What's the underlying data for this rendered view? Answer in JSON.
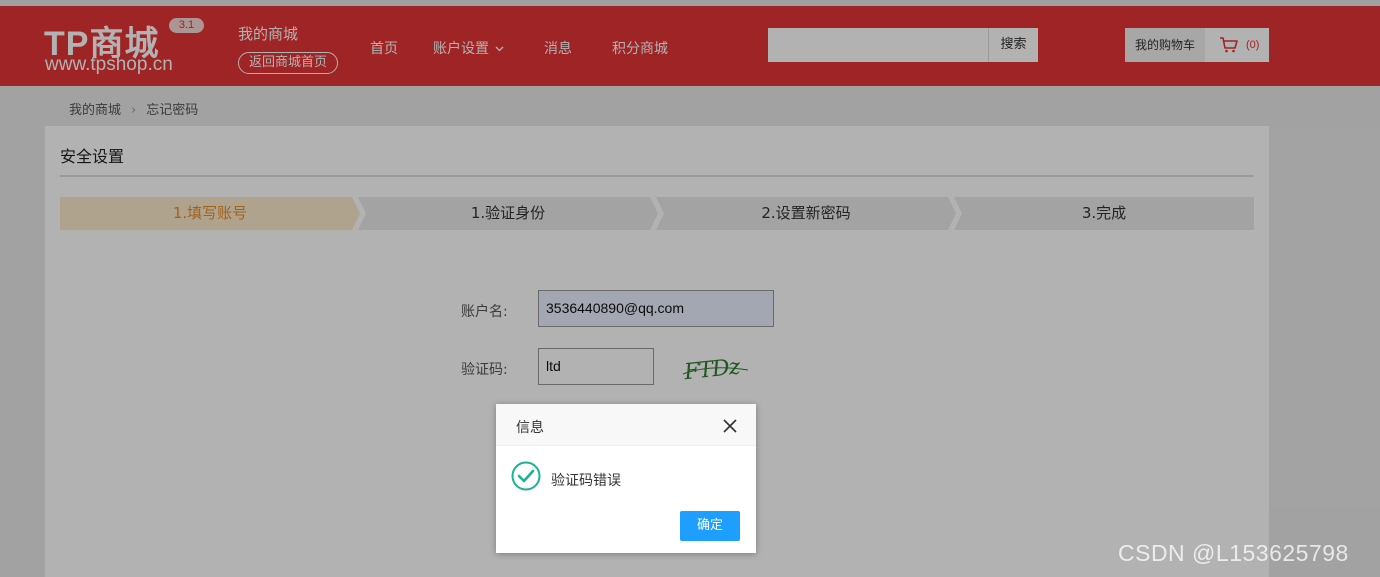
{
  "header": {
    "logo_main": "TP商城",
    "logo_version": "3.1",
    "logo_domain": "www.tpshop.cn",
    "my_mall": "我的商城",
    "back_home": "返回商城首页",
    "nav": [
      {
        "label": "首页"
      },
      {
        "label": "账户设置"
      },
      {
        "label": "消息"
      },
      {
        "label": "积分商城"
      }
    ],
    "search_placeholder": "",
    "search_button": "搜索",
    "cart_label": "我的购物车",
    "cart_count": "(0)",
    "cart_icon": "cart-icon"
  },
  "breadcrumb": {
    "items": [
      "我的商城",
      "忘记密码"
    ],
    "separator": "›"
  },
  "panel": {
    "title": "安全设置",
    "steps": [
      "1.填写账号",
      "1.验证身份",
      "2.设置新密码",
      "3.完成"
    ],
    "form": {
      "account_label": "账户名:",
      "account_value": "3536440890@qq.com",
      "captcha_label": "验证码:",
      "captcha_value": "ltd",
      "captcha_image_text": "FTDz"
    }
  },
  "dialog": {
    "title": "信息",
    "message": "验证码错误",
    "ok_button": "确定",
    "icon": "check-circle-icon"
  },
  "watermark": "CSDN @L153625798",
  "colors": {
    "brand": "#e23435",
    "active_step": "#e68d2e",
    "ok_button": "#1e9fff",
    "check_icon": "#1ab394"
  }
}
